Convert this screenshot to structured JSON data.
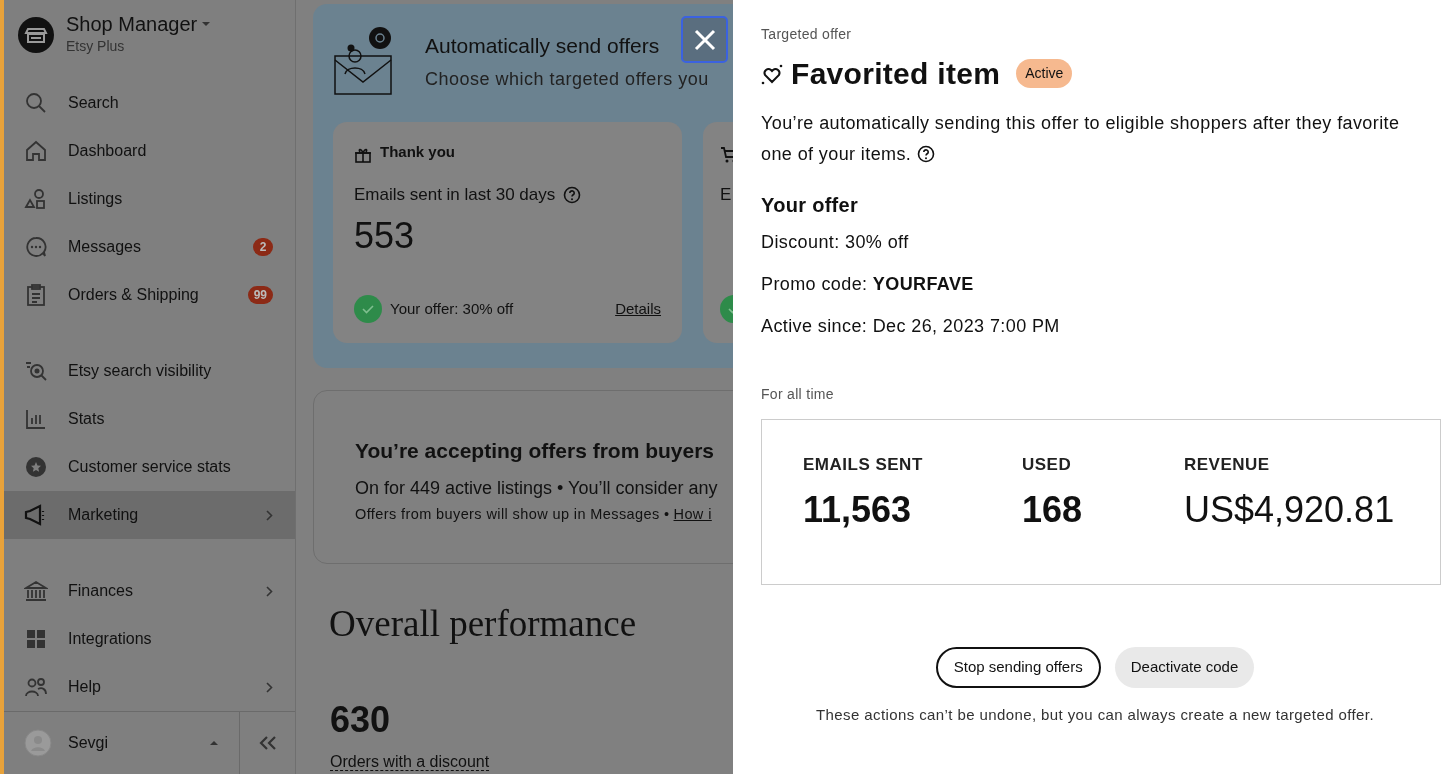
{
  "sidebar": {
    "shop": {
      "title": "Shop Manager",
      "subtitle": "Etsy Plus"
    },
    "groups": [
      {
        "items": [
          {
            "label": "Search",
            "selected": false,
            "has_submenu": false
          },
          {
            "label": "Dashboard",
            "selected": false,
            "has_submenu": false
          },
          {
            "label": "Listings",
            "selected": false,
            "has_submenu": false
          },
          {
            "label": "Messages",
            "selected": false,
            "has_submenu": false,
            "badge": "2"
          },
          {
            "label": "Orders & Shipping",
            "selected": false,
            "has_submenu": false,
            "badge": "99"
          }
        ]
      },
      {
        "items": [
          {
            "label": "Etsy search visibility",
            "selected": false,
            "has_submenu": false
          },
          {
            "label": "Stats",
            "selected": false,
            "has_submenu": false
          },
          {
            "label": "Customer service stats",
            "selected": false,
            "has_submenu": false
          },
          {
            "label": "Marketing",
            "selected": true,
            "has_submenu": true
          }
        ]
      },
      {
        "items": [
          {
            "label": "Finances",
            "selected": false,
            "has_submenu": true
          },
          {
            "label": "Integrations",
            "selected": false,
            "has_submenu": false
          },
          {
            "label": "Help",
            "selected": false,
            "has_submenu": true
          }
        ]
      }
    ],
    "user": {
      "name": "Sevgi"
    }
  },
  "main": {
    "banner": {
      "title": "Automatically send offers",
      "subtitle": "Choose which targeted offers you",
      "cards": [
        {
          "title": "Thank you",
          "metric_label": "Emails sent in last 30 days",
          "value": "553",
          "offer": "Your offer: 30% off",
          "link": "Details"
        },
        {
          "metric_label": "E"
        }
      ]
    },
    "buyer_offers": {
      "title": "You’re accepting offers from buyers",
      "line": "On for 449 active listings • You’ll consider any",
      "note": "Offers from buyers will show up in Messages •",
      "link": "How i"
    },
    "performance": {
      "title": "Overall performance",
      "value": "630",
      "label": "Orders with a discount"
    }
  },
  "panel": {
    "eyebrow": "Targeted offer",
    "title": "Favorited item",
    "status": "Active",
    "description": "You’re automatically sending this offer to eligible shoppers after they favorite one of your items.",
    "offer_heading": "Your offer",
    "details": [
      "Discount: 30% off",
      "Promo code: **YOURFAVE**",
      "Active since: Dec 26, 2023 7:00 PM"
    ],
    "period": "For all time",
    "stats": [
      {
        "label": "EMAILS SENT",
        "value": "11,563"
      },
      {
        "label": "USED",
        "value": "168"
      },
      {
        "label": "REVENUE",
        "value": "US$4,920.81"
      }
    ],
    "buttons": [
      {
        "label": "Stop sending offers",
        "kind": "outline"
      },
      {
        "label": "Deactivate code",
        "kind": "secondary"
      }
    ],
    "note": "These actions can’t be undone, but you can always create a new targeted offer."
  }
}
